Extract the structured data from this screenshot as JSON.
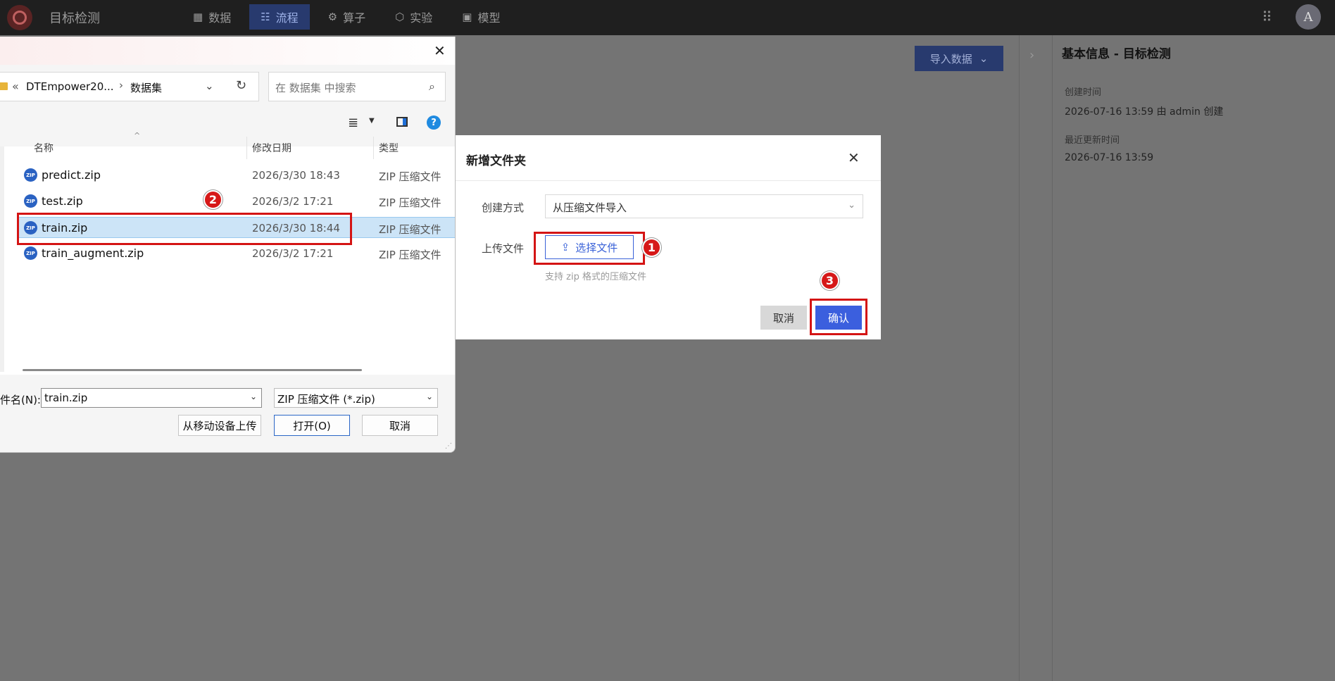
{
  "app": {
    "title": "目标检测",
    "nav": [
      {
        "label": "数据",
        "icon": "table-icon"
      },
      {
        "label": "流程",
        "icon": "flow-icon",
        "active": true
      },
      {
        "label": "算子",
        "icon": "operator-icon"
      },
      {
        "label": "实验",
        "icon": "cube-icon"
      },
      {
        "label": "模型",
        "icon": "save-icon"
      }
    ],
    "avatar": "A"
  },
  "main": {
    "import_label": "导入数据"
  },
  "info_panel": {
    "title": "基本信息 - 目标检测",
    "created_label": "创建时间",
    "created_value": "2026-07-16 13:59 由 admin 创建",
    "updated_label": "最近更新时间",
    "updated_value": "2026-07-16 13:59"
  },
  "new_folder_dialog": {
    "title": "新增文件夹",
    "method_label": "创建方式",
    "method_value": "从压缩文件导入",
    "upload_label": "上传文件",
    "upload_button": "选择文件",
    "hint": "支持 zip 格式的压缩文件",
    "cancel": "取消",
    "confirm": "确认"
  },
  "file_dialog": {
    "breadcrumb": [
      "DTEmpower20...",
      "数据集"
    ],
    "breadcrumb_prefix": "«",
    "search_placeholder": "在 数据集 中搜索",
    "columns": [
      "名称",
      "修改日期",
      "类型"
    ],
    "files": [
      {
        "name": "predict.zip",
        "date": "2026/3/30 18:43",
        "type": "ZIP 压缩文件"
      },
      {
        "name": "test.zip",
        "date": "2026/3/2 17:21",
        "type": "ZIP 压缩文件"
      },
      {
        "name": "train.zip",
        "date": "2026/3/30 18:44",
        "type": "ZIP 压缩文件",
        "selected": true
      },
      {
        "name": "train_augment.zip",
        "date": "2026/3/2 17:21",
        "type": "ZIP 压缩文件"
      }
    ],
    "filename_label": "件名(N):",
    "filename_value": "train.zip",
    "filetype_value": "ZIP 压缩文件 (*.zip)",
    "mobile_upload": "从移动设备上传",
    "open": "打开(O)",
    "cancel": "取消",
    "help": "?"
  },
  "annotations": [
    "1",
    "2",
    "3"
  ],
  "colors": {
    "highlight": "#d41414",
    "primary": "#3b5fde",
    "selected_row": "#cce4f7"
  }
}
